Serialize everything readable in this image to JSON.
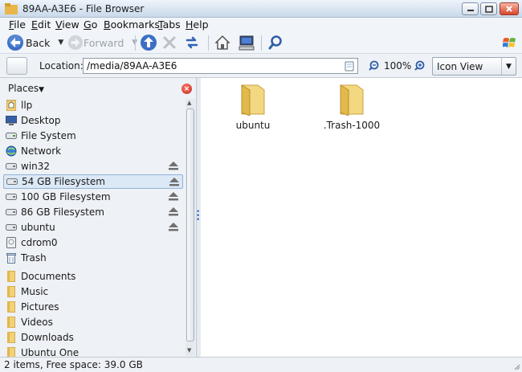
{
  "window": {
    "title": "89AA-A3E6 - File Browser"
  },
  "menu": [
    {
      "label": "File",
      "key": "F",
      "rest": "ile"
    },
    {
      "label": "Edit",
      "key": "E",
      "rest": "dit"
    },
    {
      "label": "View",
      "key": "V",
      "rest": "iew"
    },
    {
      "label": "Go",
      "key": "G",
      "rest": "o"
    },
    {
      "label": "Bookmarks",
      "key": "B",
      "rest": "ookmarks"
    },
    {
      "label": "Tabs",
      "key": "T",
      "rest": "abs"
    },
    {
      "label": "Help",
      "key": "H",
      "rest": "elp"
    }
  ],
  "toolbar": {
    "back_label": "Back",
    "forward_label": "Forward",
    "forward_disabled": true
  },
  "location": {
    "label": "Location:",
    "value": "/media/89AA-A3E6",
    "zoom": "100%",
    "view_mode": "Icon View"
  },
  "sidebar": {
    "header": "Places",
    "items": [
      {
        "label": "llp",
        "icon": "home-folder-icon"
      },
      {
        "label": "Desktop",
        "icon": "desktop-icon"
      },
      {
        "label": "File System",
        "icon": "drive-icon"
      },
      {
        "label": "Network",
        "icon": "network-icon"
      },
      {
        "label": "win32",
        "icon": "drive-icon",
        "eject": true
      },
      {
        "label": "54 GB Filesystem",
        "icon": "drive-icon",
        "eject": true,
        "selected": true
      },
      {
        "label": "100 GB Filesystem",
        "icon": "drive-icon",
        "eject": true
      },
      {
        "label": "86 GB Filesystem",
        "icon": "drive-icon",
        "eject": true
      },
      {
        "label": "ubuntu",
        "icon": "drive-icon",
        "eject": true
      },
      {
        "label": "cdrom0",
        "icon": "cdrom-icon"
      },
      {
        "label": "Trash",
        "icon": "trash-icon"
      },
      {
        "label": "Documents",
        "icon": "folder-icon"
      },
      {
        "label": "Music",
        "icon": "music-folder-icon"
      },
      {
        "label": "Pictures",
        "icon": "pictures-folder-icon"
      },
      {
        "label": "Videos",
        "icon": "videos-folder-icon"
      },
      {
        "label": "Downloads",
        "icon": "downloads-folder-icon"
      },
      {
        "label": "Ubuntu One",
        "icon": "folder-icon"
      }
    ]
  },
  "files": [
    {
      "name": "ubuntu",
      "icon": "folder-icon"
    },
    {
      "name": ".Trash-1000",
      "icon": "folder-icon"
    }
  ],
  "status": {
    "text": "2 items, Free space: 39.0 GB"
  },
  "colors": {
    "selection_bg": "#dbe8f6",
    "selection_border": "#8fb2d8",
    "folder": "#f2d277"
  }
}
